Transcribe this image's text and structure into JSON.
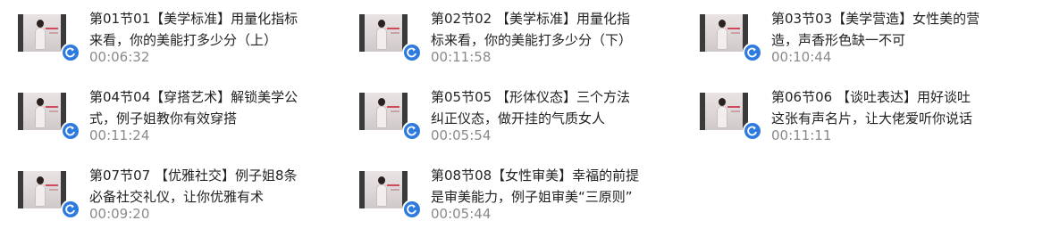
{
  "lessons": [
    {
      "title_line1": "第01节01【美学标准】用量化指标",
      "title_line2": "来看，你的美能打多少分（上）",
      "duration": "00:06:32"
    },
    {
      "title_line1": "第02节02 【美学标准】用量化指",
      "title_line2": "标来看，你的美能打多少分（下）",
      "duration": "00:11:58"
    },
    {
      "title_line1": "第03节03【美学营造】女性美的营",
      "title_line2": "造，声香形色缺一不可",
      "duration": "00:10:44"
    },
    {
      "title_line1": "第04节04【穿搭艺术】解锁美学公",
      "title_line2": "式，例子姐教你有效穿搭",
      "duration": "00:11:24"
    },
    {
      "title_line1": "第05节05 【形体仪态】三个方法",
      "title_line2": "纠正仪态，做开挂的气质女人",
      "duration": "00:05:54"
    },
    {
      "title_line1": "第06节06 【谈吐表达】用好谈吐",
      "title_line2": "这张有声名片，让大佬爱听你说话",
      "duration": "00:11:11"
    },
    {
      "title_line1": "第07节07 【优雅社交】例子姐8条",
      "title_line2": "必备社交礼仪，让你优雅有术",
      "duration": "00:09:20"
    },
    {
      "title_line1": "第08节08【女性审美】幸福的前提",
      "title_line2": "是审美能力，例子姐审美“三原则”",
      "duration": "00:05:44"
    }
  ],
  "icons": {
    "play": "play-circle-icon",
    "thumbnail": "video-thumbnail"
  },
  "colors": {
    "play_badge": "#2e7be0",
    "title": "#222222",
    "duration": "#8a8a8a"
  }
}
